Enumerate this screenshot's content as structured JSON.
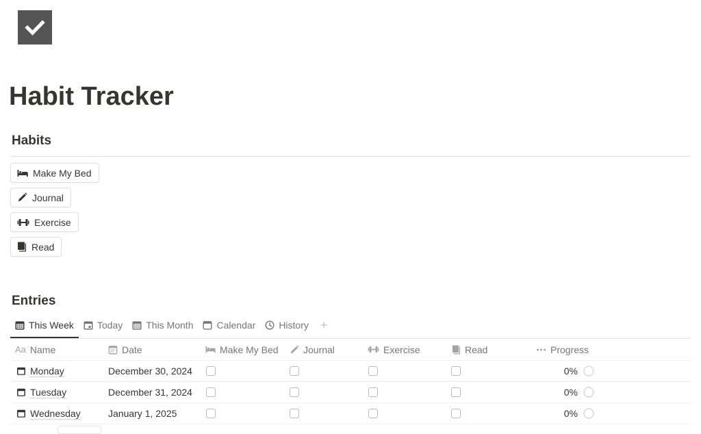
{
  "page": {
    "icon": "checkmark-icon",
    "title": "Habit Tracker"
  },
  "habits": {
    "heading": "Habits",
    "buttons": [
      {
        "label": "Make My Bed",
        "icon": "bed-icon"
      },
      {
        "label": "Journal",
        "icon": "pencil-icon"
      },
      {
        "label": "Exercise",
        "icon": "dumbbell-icon"
      },
      {
        "label": "Read",
        "icon": "book-icon"
      }
    ]
  },
  "entries": {
    "heading": "Entries",
    "tabs": [
      {
        "label": "This Week",
        "icon": "calendar-grid-icon",
        "active": true
      },
      {
        "label": "Today",
        "icon": "calendar-day-icon",
        "active": false
      },
      {
        "label": "This Month",
        "icon": "calendar-grid-icon",
        "active": false
      },
      {
        "label": "Calendar",
        "icon": "calendar-icon",
        "active": false
      },
      {
        "label": "History",
        "icon": "clock-icon",
        "active": false
      }
    ],
    "add_view": "+",
    "columns": {
      "name": {
        "prefix": "Aa",
        "label": "Name"
      },
      "date": {
        "label": "Date",
        "icon": "calendar-icon"
      },
      "make_my_bed": {
        "label": "Make My Bed",
        "icon": "bed-icon"
      },
      "journal": {
        "label": "Journal",
        "icon": "pencil-icon"
      },
      "exercise": {
        "label": "Exercise",
        "icon": "dumbbell-icon"
      },
      "read": {
        "label": "Read",
        "icon": "book-icon"
      },
      "progress": {
        "label": "Progress",
        "icon": "more-dots-icon"
      }
    },
    "rows": [
      {
        "name": "Monday",
        "date": "December 30, 2024",
        "make_my_bed": false,
        "journal": false,
        "exercise": false,
        "read": false,
        "progress": "0%"
      },
      {
        "name": "Tuesday",
        "date": "December 31, 2024",
        "make_my_bed": false,
        "journal": false,
        "exercise": false,
        "read": false,
        "progress": "0%"
      },
      {
        "name": "Wednesday",
        "date": "January 1, 2025",
        "make_my_bed": false,
        "journal": false,
        "exercise": false,
        "read": false,
        "progress": "0%"
      }
    ]
  },
  "colors": {
    "text": "#37352f",
    "muted": "#787774",
    "border": "#e4e4e2",
    "icon_bg": "#545454"
  }
}
